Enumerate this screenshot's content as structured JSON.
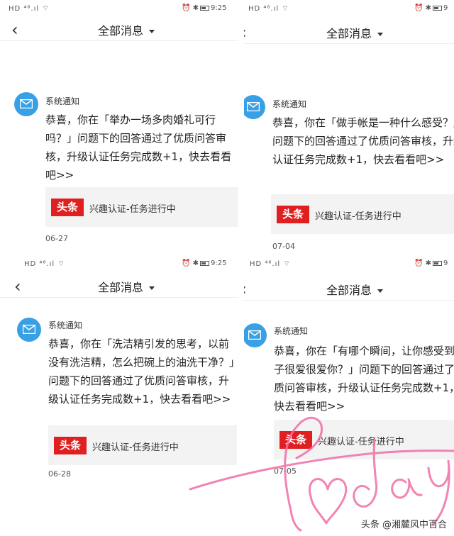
{
  "status_bar": {
    "signal": "HD ⁴⁶.ıl ⌔",
    "time": "9:25",
    "time_partial": "9"
  },
  "nav": {
    "title": "全部消息"
  },
  "message": {
    "sender": "系统通知",
    "card_logo": "头条",
    "card_text": "兴趣认证-任务进行中"
  },
  "panels": [
    {
      "text": "恭喜，你在「举办一场多肉婚礼可行吗？」问题下的回答通过了优质问答审核，升级认证任务完成数+1，快去看看吧>>",
      "date": "06-27"
    },
    {
      "text": "恭喜，你在「做手帐是一种什么感受？」问题下的回答通过了优质问答审核，升级认证任务完成数+1，快去看看吧>>",
      "date": "07-04"
    },
    {
      "text": "恭喜，你在「洗洁精引发的思考，以前没有洗洁精，怎么把碗上的油洗干净？」问题下的回答通过了优质问答审核，升级认证任务完成数+1，快去看看吧>>",
      "date": "06-28"
    },
    {
      "text": "恭喜，你在「有哪个瞬间，让你感受到孩子很爱很爱你？」问题下的回答通过了优质问答审核，升级认证任务完成数+1，快去看看吧>>",
      "date": "07-05"
    }
  ],
  "watermark": "头条 @湘麓风中百合",
  "colors": {
    "avatar": "#3aa0e6",
    "logo_red": "#e02020",
    "handwriting_pink": "#f06fa8"
  }
}
